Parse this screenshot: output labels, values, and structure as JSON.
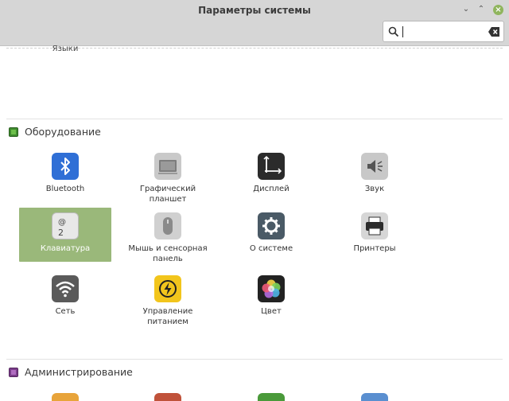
{
  "window": {
    "title": "Параметры системы",
    "controls": {
      "minimize": "⌄",
      "maximize": "⌃",
      "close": "×"
    }
  },
  "search": {
    "value": "",
    "placeholder": ""
  },
  "previous_section": {
    "cut_label": "Языки"
  },
  "sections": [
    {
      "title": "Оборудование",
      "color": "#3f8b2e",
      "items": [
        {
          "label": "Bluetooth",
          "icon": "bluetooth-icon",
          "selected": false
        },
        {
          "label": "Графический планшет",
          "icon": "tablet-icon",
          "selected": false
        },
        {
          "label": "Дисплей",
          "icon": "display-icon",
          "selected": false
        },
        {
          "label": "Звук",
          "icon": "sound-icon",
          "selected": false
        },
        {
          "label": "Клавиатура",
          "icon": "keyboard-icon",
          "selected": true
        },
        {
          "label": "Мышь и сенсорная панель",
          "icon": "mouse-icon",
          "selected": false
        },
        {
          "label": "О системе",
          "icon": "gear-icon",
          "selected": false
        },
        {
          "label": "Принтеры",
          "icon": "printer-icon",
          "selected": false
        },
        {
          "label": "Сеть",
          "icon": "wifi-icon",
          "selected": false
        },
        {
          "label": "Управление питанием",
          "icon": "power-icon",
          "selected": false
        },
        {
          "label": "Цвет",
          "icon": "color-icon",
          "selected": false
        }
      ]
    },
    {
      "title": "Администрирование",
      "color": "#7a3d8a"
    }
  ],
  "colors": {
    "selected_bg": "#9ab87a",
    "titlebar": "#d6d6d6",
    "close_button": "#8fb55d"
  }
}
